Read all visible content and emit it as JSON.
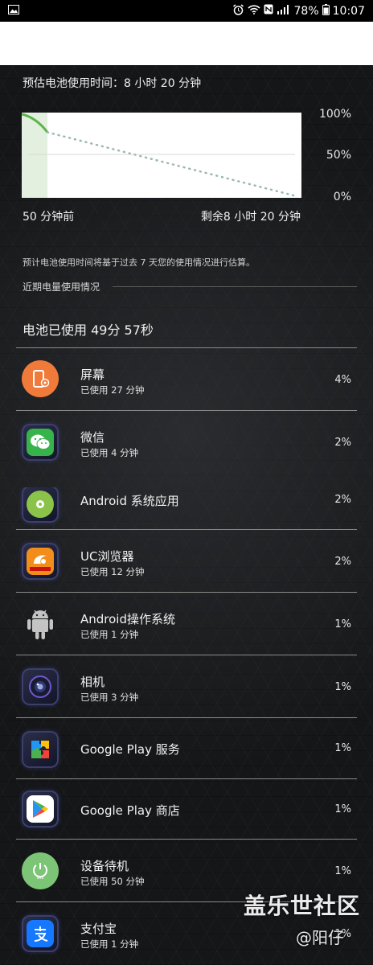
{
  "status_bar": {
    "battery_percent": "78%",
    "time": "10:07"
  },
  "estimate": {
    "label": "预估电池使用时间：8 小时 20 分钟"
  },
  "chart": {
    "y_labels": [
      "100%",
      "50%",
      "0%"
    ],
    "x_left": "50 分钟前",
    "x_right": "剩余8 小时 20 分钟",
    "line_color": "#5cb54b",
    "projection_color": "#9ab8b3"
  },
  "chart_data": {
    "type": "line",
    "title": "",
    "xlabel": "",
    "ylabel": "",
    "ylim": [
      0,
      100
    ],
    "series": [
      {
        "x": [
          "50 分钟前",
          "现在"
        ],
        "values": [
          100,
          78
        ]
      },
      {
        "x": [
          "现在",
          "剩余8 小时 20 分钟"
        ],
        "values": [
          78,
          0
        ]
      }
    ]
  },
  "note": "预计电池使用时间将基于过去 7 天您的使用情况进行估算。",
  "section_title": "近期电量使用情况",
  "battery_used": "电池已使用 49分 57秒",
  "apps": [
    {
      "name": "屏幕",
      "usage": "已使用 27 分钟",
      "percent": "4%",
      "icon": "screen-icon"
    },
    {
      "name": "微信",
      "usage": "已使用 4 分钟",
      "percent": "2%",
      "icon": "wechat-icon"
    },
    {
      "name": "Android 系统应用",
      "usage": "",
      "percent": "2%",
      "icon": "android-system-app-icon"
    },
    {
      "name": "UC浏览器",
      "usage": "已使用 12 分钟",
      "percent": "2%",
      "icon": "uc-browser-icon"
    },
    {
      "name": "Android操作系统",
      "usage": "已使用 1 分钟",
      "percent": "1%",
      "icon": "android-os-icon"
    },
    {
      "name": "相机",
      "usage": "已使用 3 分钟",
      "percent": "1%",
      "icon": "camera-icon"
    },
    {
      "name": "Google Play 服务",
      "usage": "",
      "percent": "1%",
      "icon": "google-play-services-icon"
    },
    {
      "name": "Google Play 商店",
      "usage": "",
      "percent": "1%",
      "icon": "google-play-store-icon"
    },
    {
      "name": "设备待机",
      "usage": "已使用 50 分钟",
      "percent": "1%",
      "icon": "standby-icon"
    },
    {
      "name": "支付宝",
      "usage": "已使用 1 分钟",
      "percent": "1%",
      "icon": "alipay-icon"
    }
  ],
  "watermark": {
    "line1": "盖乐世社区",
    "line2": "@阳仔"
  }
}
